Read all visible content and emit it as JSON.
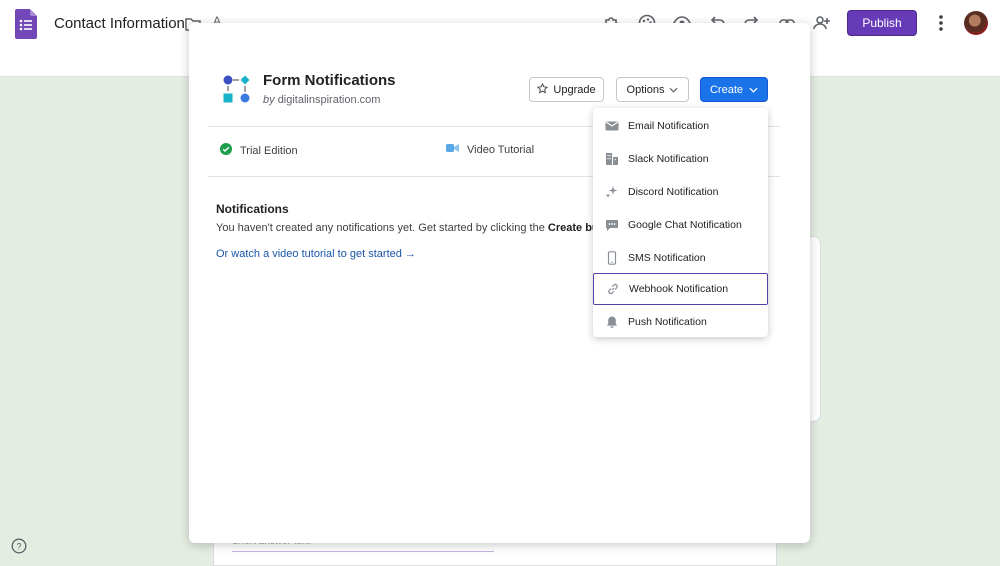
{
  "header": {
    "doc_title": "Contact Information",
    "peek_glyph": "A",
    "publish_label": "Publish",
    "icons": [
      "folder-icon",
      "addon-puzzle-icon",
      "palette-icon",
      "preview-eye-icon",
      "undo-icon",
      "redo-icon",
      "link-icon",
      "add-collaborator-icon",
      "more-vert-icon"
    ]
  },
  "addon": {
    "title": "Form Notifications",
    "by_prefix": "by",
    "by_site": "digitalinspiration.com",
    "buttons": {
      "upgrade": "Upgrade",
      "options": "Options",
      "create": "Create"
    },
    "info": {
      "trial": "Trial Edition",
      "video": "Video Tutorial"
    },
    "notifications": {
      "heading": "Notifications",
      "empty_text_pre": "You haven't created any notifications yet. Get started by clicking the ",
      "empty_text_bold": "Create button",
      "video_link": "Or watch a video tutorial to get started →"
    }
  },
  "dropdown": {
    "items": [
      {
        "label": "Email Notification",
        "icon": "email-icon",
        "selected": false
      },
      {
        "label": "Slack Notification",
        "icon": "slack-building-icon",
        "selected": false
      },
      {
        "label": "Discord Notification",
        "icon": "sparkle-icon",
        "selected": false
      },
      {
        "label": "Google Chat Notification",
        "icon": "chat-bubble-icon",
        "selected": false
      },
      {
        "label": "SMS Notification",
        "icon": "phone-icon",
        "selected": false
      },
      {
        "label": "Webhook Notification",
        "icon": "link-icon",
        "selected": true
      },
      {
        "label": "Push Notification",
        "icon": "bell-icon",
        "selected": false
      }
    ]
  },
  "background_form": {
    "short_answer_text": "Short answer text"
  },
  "colors": {
    "publish": "#673ab7",
    "create": "#1a73e8",
    "selected_outline": "#5b3fa8",
    "page_bg": "#e4ede2"
  }
}
